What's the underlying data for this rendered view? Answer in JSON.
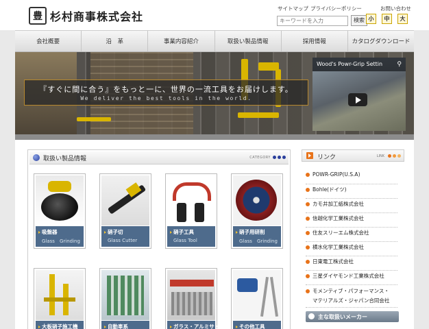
{
  "header": {
    "logo_mark": "豊",
    "company_name": "杉村商事株式会社",
    "links": [
      "サイトマップ",
      "プライバシーポリシー",
      "お問い合わせ"
    ],
    "search": {
      "placeholder": "キーワードを入力",
      "button": "検索"
    },
    "font_size": [
      "小",
      "中",
      "大"
    ]
  },
  "nav": [
    "会社概要",
    "沿　革",
    "事業内容紹介",
    "取扱い製品情報",
    "採用情報",
    "カタログダウンロード"
  ],
  "hero": {
    "catch_jp": "『すぐに間に合う』をもっと一に、世界の一流工具をお届けします。",
    "catch_en": "We deliver the best tools in the world.",
    "video_title": "Wood's Powr-Grip Settin",
    "share_icon": "share-icon",
    "play_icon": "play-icon"
  },
  "products": {
    "title": "取扱い製品情報",
    "label": "CATEGORY",
    "items": [
      {
        "name": "吸盤器",
        "en": "Glass　Grinding"
      },
      {
        "name": "硝子切",
        "en": "Glass Cutter"
      },
      {
        "name": "硝子工具",
        "en": "Glass Tool"
      },
      {
        "name": "硝子用研削",
        "en": "Glass　Grinding"
      },
      {
        "name": "大板硝子施工機",
        "en": ""
      },
      {
        "name": "自動車系",
        "en": ""
      },
      {
        "name": "ガラス・アルミサッ",
        "en": ""
      },
      {
        "name": "その他工具",
        "en": ""
      }
    ]
  },
  "links": {
    "title": "リンク",
    "label": "LINK",
    "items": [
      "POWR-GRIP(U.S.A)",
      "Bohle(ドイツ)",
      "カモ井加工紙株式会社",
      "信越化学工業株式会社",
      "住友スリーエム株式会社",
      "横水化学工業株式会社",
      "日東電工株式会社",
      "三星ダイヤモンド工業株式会社",
      "モメンティブ・パフォーマンス・",
      "マテリアルズ・ジャパン合同会社"
    ],
    "bottom_title": "主な取扱いメーカー"
  },
  "colors": {
    "caption_bg": "#4e6b8c",
    "accent_orange": "#e8731a",
    "accent_blue": "#2a3f9c",
    "banner_border": "#b8892e"
  }
}
